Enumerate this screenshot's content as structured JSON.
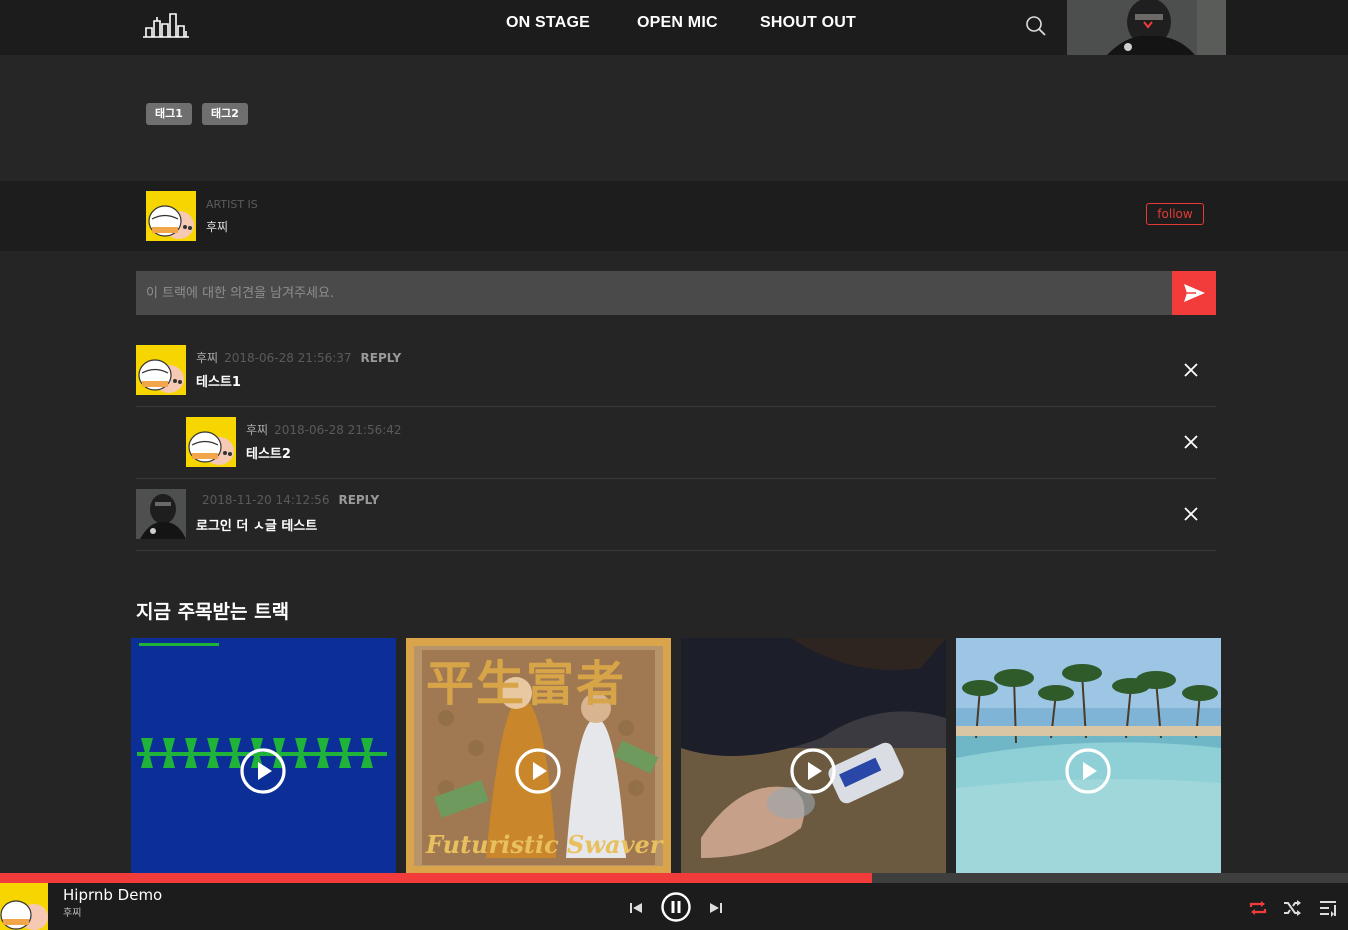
{
  "nav": {
    "links": [
      "ON STAGE",
      "OPEN MIC",
      "SHOUT OUT"
    ],
    "icons": [
      "logo-city-icon",
      "search-icon",
      "chevron-down-icon"
    ]
  },
  "tags": [
    "태그1",
    "태그2"
  ],
  "artist": {
    "label": "ARTIST IS",
    "name": "후찌",
    "follow_label": "follow"
  },
  "comment_form": {
    "placeholder": "이 트랙에 대한 의견을 남겨주세요."
  },
  "comments": [
    {
      "author": "후찌",
      "date": "2018-06-28 21:56:37",
      "reply": "REPLY",
      "text": "테스트1"
    },
    {
      "author": "후찌",
      "date": "2018-06-28 21:56:42",
      "reply": "",
      "text": "테스트2"
    },
    {
      "author": "",
      "date": "2018-11-20 14:12:56",
      "reply": "REPLY",
      "text": "로그인 더 ㅅ글 테스트"
    }
  ],
  "trending": {
    "title": "지금 주목받는 트랙",
    "card_overlay_texts": [
      "平生富者",
      "Futuristic Swaver"
    ]
  },
  "player": {
    "title": "Hiprnb Demo",
    "artist": "후찌",
    "progress": 0.647,
    "accent": "#f23b3b"
  },
  "colors": {
    "accent": "#f23b3b",
    "nav_bg": "#1c1c1c",
    "page_bg": "#252525"
  }
}
